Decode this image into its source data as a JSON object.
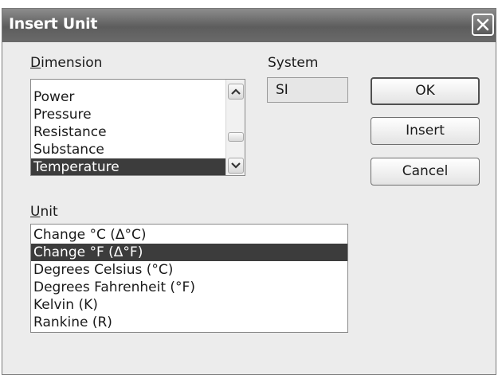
{
  "window": {
    "title": "Insert Unit"
  },
  "dimension": {
    "label": "Dimension",
    "items": [
      {
        "label": "Power",
        "selected": false
      },
      {
        "label": "Pressure",
        "selected": false
      },
      {
        "label": "Resistance",
        "selected": false
      },
      {
        "label": "Substance",
        "selected": false
      },
      {
        "label": "Temperature",
        "selected": true
      }
    ]
  },
  "system": {
    "label": "System",
    "value": "SI"
  },
  "buttons": {
    "ok": "OK",
    "insert": "Insert",
    "cancel": "Cancel"
  },
  "unit": {
    "label": "Unit",
    "items": [
      {
        "label": "Change °C (Δ°C)",
        "selected": false
      },
      {
        "label": "Change °F (Δ°F)",
        "selected": true
      },
      {
        "label": "Degrees Celsius (°C)",
        "selected": false
      },
      {
        "label": "Degrees Fahrenheit (°F)",
        "selected": false
      },
      {
        "label": "Kelvin (K)",
        "selected": false
      },
      {
        "label": "Rankine (R)",
        "selected": false
      }
    ]
  }
}
